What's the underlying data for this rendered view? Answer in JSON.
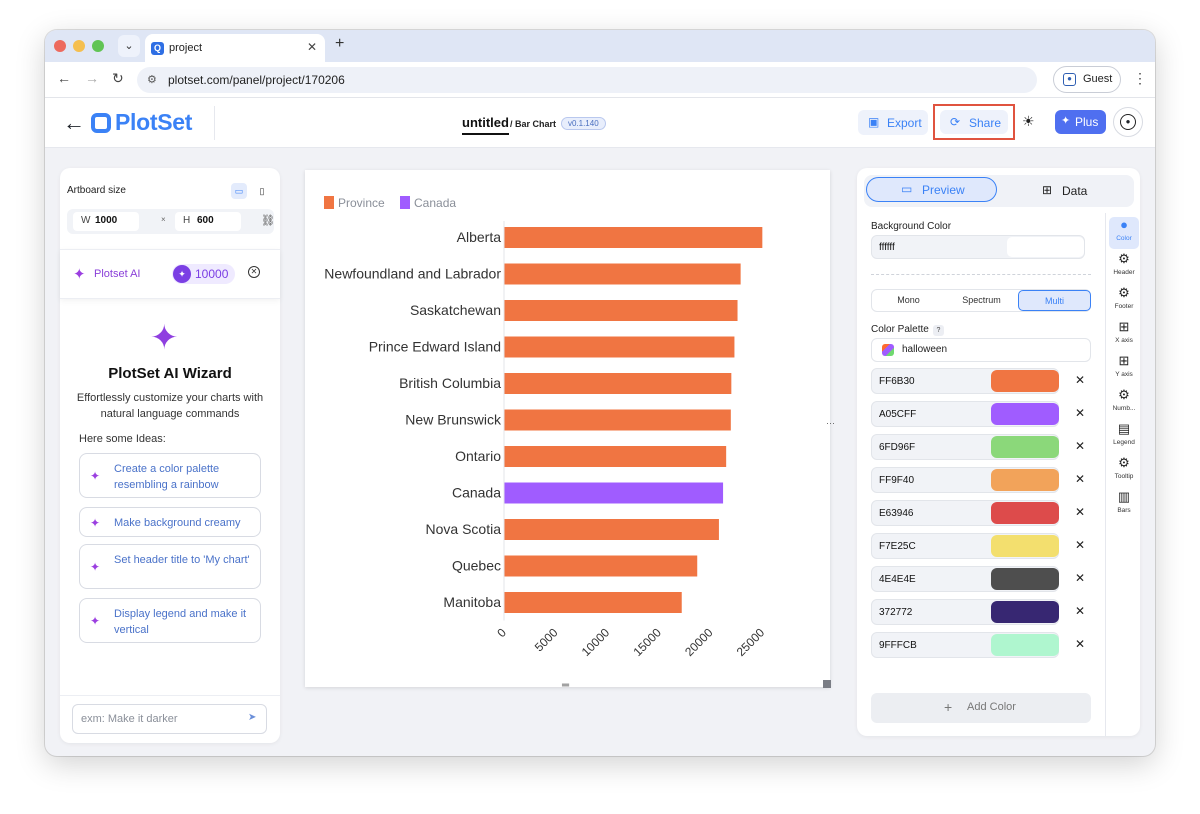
{
  "browser": {
    "tab_title": "project",
    "tab_close": "✕",
    "new_tab": "+",
    "url": "plotset.com/panel/project/170206",
    "guest_label": "Guest"
  },
  "header": {
    "logo_text": "PlotSet",
    "project_name": "untitled",
    "chart_type": "/ Bar Chart",
    "version": "v0.1.140",
    "export_label": "Export",
    "share_label": "Share",
    "plus_label": "Plus"
  },
  "left_panel": {
    "artboard_label": "Artboard size",
    "width_label": "W",
    "width_value": "1000",
    "times": "×",
    "height_label": "H",
    "height_value": "600",
    "ai_label": "Plotset AI",
    "ai_credits": "10000",
    "wizard_title": "PlotSet AI Wizard",
    "wizard_subtitle": "Effortlessly customize your charts with natural language commands",
    "ideas_label": "Here some Ideas:",
    "ideas": [
      "Create a color palette resembling a rainbow",
      "Make background creamy",
      "Set header title to 'My chart'",
      "Display legend and make it vertical"
    ],
    "prompt_placeholder": "exm: Make it darker"
  },
  "chart_data": {
    "type": "bar",
    "orientation": "horizontal",
    "legend": [
      {
        "name": "Province",
        "color": "#F07542"
      },
      {
        "name": "Canada",
        "color": "#A05CFF"
      }
    ],
    "legend_placement": "top-left",
    "categories": [
      "Alberta",
      "Newfoundland and Labrador",
      "Saskatchewan",
      "Prince Edward Island",
      "British Columbia",
      "New Brunswick",
      "Ontario",
      "Canada",
      "Nova Scotia",
      "Quebec",
      "Manitoba"
    ],
    "values": [
      25000,
      22900,
      22600,
      22300,
      22000,
      21950,
      21500,
      21200,
      20800,
      18700,
      17200
    ],
    "highlight": [
      "Province",
      "Province",
      "Province",
      "Province",
      "Province",
      "Province",
      "Province",
      "Canada",
      "Province",
      "Province",
      "Province"
    ],
    "x_ticks": [
      "0",
      "5000",
      "10000",
      "15000",
      "20000",
      "25000"
    ],
    "xlim": [
      0,
      27000
    ],
    "grid": false
  },
  "right_panel": {
    "preview_label": "Preview",
    "data_label": "Data",
    "bg_color_label": "Background Color",
    "bg_color_value": "ffffff",
    "modes": [
      "Mono",
      "Spectrum",
      "Multi"
    ],
    "active_mode": "Multi",
    "palette_label": "Color Palette",
    "palette_help": "?",
    "palette_value": "halloween",
    "colors": [
      {
        "hex": "FF6B30",
        "color": "#F07542"
      },
      {
        "hex": "A05CFF",
        "color": "#A05CFF"
      },
      {
        "hex": "6FD96F",
        "color": "#8BD87A"
      },
      {
        "hex": "FF9F40",
        "color": "#F2A35A"
      },
      {
        "hex": "E63946",
        "color": "#DD4B4B"
      },
      {
        "hex": "F7E25C",
        "color": "#F3DF6E"
      },
      {
        "hex": "4E4E4E",
        "color": "#4E4E4E"
      },
      {
        "hex": "372772",
        "color": "#372772"
      },
      {
        "hex": "9FFFCB",
        "color": "#AFF6CF"
      }
    ],
    "delete_glyph": "✕",
    "add_color_label": "Add Color",
    "rail": [
      "Color",
      "Header",
      "Footer",
      "X axis",
      "Y axis",
      "Numb...",
      "Legend",
      "Tooltip",
      "Bars"
    ],
    "rail_active": "Color"
  }
}
